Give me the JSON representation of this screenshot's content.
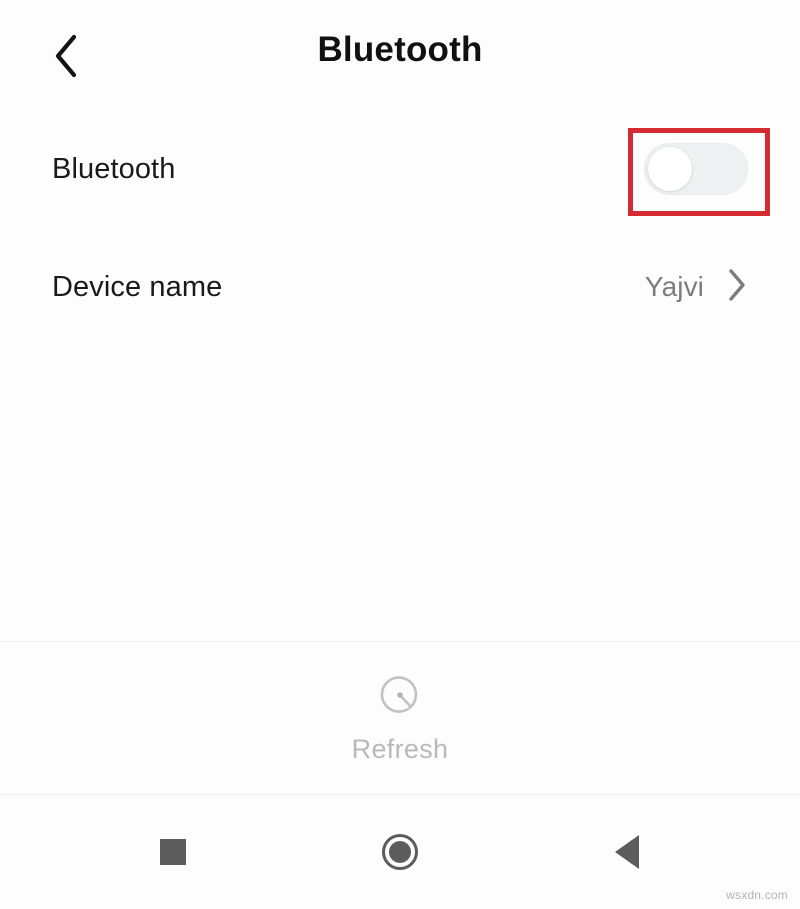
{
  "header": {
    "title": "Bluetooth",
    "back_icon": "chevron-left-icon"
  },
  "settings": {
    "rows": [
      {
        "label": "Bluetooth",
        "control": "toggle",
        "toggle_state": "off",
        "highlighted": true
      },
      {
        "label": "Device name",
        "control": "value-chevron",
        "value": "Yajvi",
        "chevron_icon": "chevron-right-icon"
      }
    ]
  },
  "refresh": {
    "label": "Refresh",
    "icon": "refresh-scan-icon"
  },
  "navbar": {
    "recents_label": "Recents",
    "home_label": "Home",
    "back_label": "Back",
    "recents_icon": "square-icon",
    "home_icon": "circle-icon",
    "back_icon": "triangle-left-icon"
  },
  "watermark": {
    "text": "wsxdn.com"
  },
  "colors": {
    "annotation_red": "#d52b33",
    "background": "#fdfdfd",
    "primary_text": "#1a1a1a",
    "secondary_text": "#7d7d7d",
    "muted_text": "#b9b9b9",
    "nav_icon": "#5c5c5c",
    "toggle_track_off": "#eef0f1",
    "toggle_knob": "#ffffff"
  }
}
